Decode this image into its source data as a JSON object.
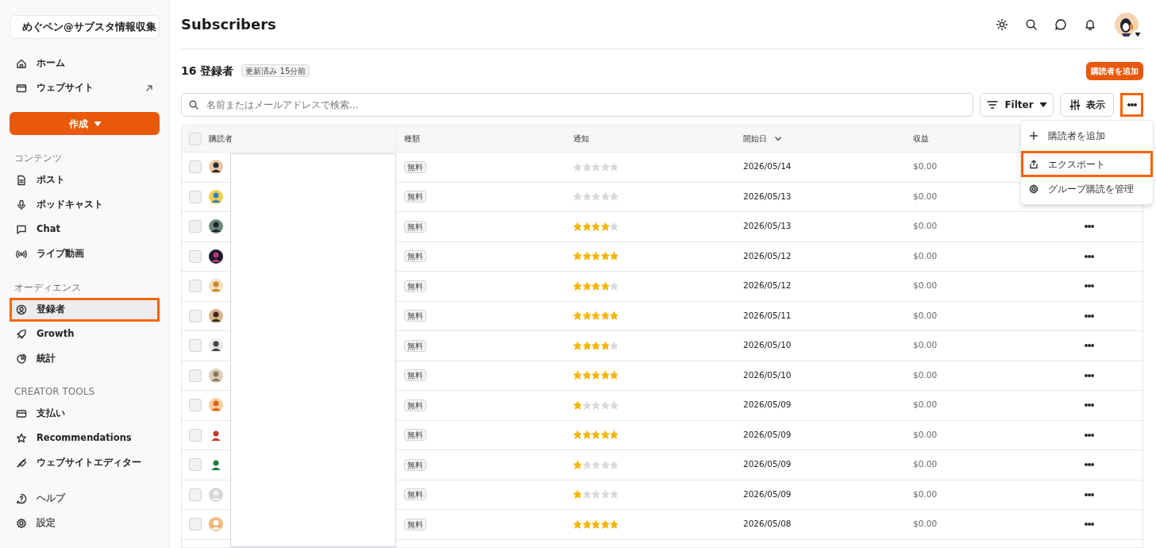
{
  "sidebar": {
    "brand": "めぐペン@サブスタ情報収集",
    "nav": [
      {
        "label": "ホーム",
        "selected": false,
        "highlighted": false,
        "external": false
      },
      {
        "label": "ウェブサイト",
        "selected": false,
        "highlighted": false,
        "external": true
      }
    ],
    "create_button": "作成",
    "sections": [
      {
        "heading": "コンテンツ",
        "items": [
          {
            "label": "ポスト",
            "selected": false,
            "highlighted": false
          },
          {
            "label": "ポッドキャスト",
            "selected": false,
            "highlighted": false
          },
          {
            "label": "Chat",
            "selected": false,
            "highlighted": false
          },
          {
            "label": "ライブ動画",
            "selected": false,
            "highlighted": false
          }
        ]
      },
      {
        "heading": "オーディエンス",
        "items": [
          {
            "label": "登録者",
            "selected": true,
            "highlighted": true
          },
          {
            "label": "Growth",
            "selected": false,
            "highlighted": false
          },
          {
            "label": "統計",
            "selected": false,
            "highlighted": false
          }
        ]
      },
      {
        "heading": "CREATOR TOOLS",
        "items": [
          {
            "label": "支払い",
            "selected": false,
            "highlighted": false
          },
          {
            "label": "Recommendations",
            "selected": false,
            "highlighted": false
          },
          {
            "label": "ウェブサイトエディター",
            "selected": false,
            "highlighted": false
          }
        ]
      }
    ],
    "footer": [
      {
        "label": "ヘルプ",
        "selected": false,
        "highlighted": false
      },
      {
        "label": "設定",
        "selected": false,
        "highlighted": false
      }
    ]
  },
  "header": {
    "title": "Subscribers"
  },
  "summary": {
    "count": "16 登録者",
    "updated": "更新済み 15分前",
    "add_button": "購読者を追加"
  },
  "search": {
    "placeholder": "名前またはメールアドレスで検索..."
  },
  "toolbar": {
    "filter": "Filter",
    "view": "表示",
    "more_highlighted": true
  },
  "table": {
    "all_checked": false,
    "columns": [
      {
        "label": "購読者",
        "sorted": false
      },
      {
        "label": "種類",
        "sorted": false
      },
      {
        "label": "通知",
        "sorted": false
      },
      {
        "label": "開始日",
        "sorted": true
      },
      {
        "label": "収益",
        "sorted": false
      }
    ],
    "rows": [
      {
        "checked": false,
        "type": "無料",
        "stars": 0,
        "start": "2026/05/14",
        "revenue": "$0.00"
      },
      {
        "checked": false,
        "type": "無料",
        "stars": 0,
        "start": "2026/05/13",
        "revenue": "$0.00"
      },
      {
        "checked": false,
        "type": "無料",
        "stars": 4,
        "start": "2026/05/13",
        "revenue": "$0.00"
      },
      {
        "checked": false,
        "type": "無料",
        "stars": 5,
        "start": "2026/05/12",
        "revenue": "$0.00"
      },
      {
        "checked": false,
        "type": "無料",
        "stars": 4,
        "start": "2026/05/12",
        "revenue": "$0.00"
      },
      {
        "checked": false,
        "type": "無料",
        "stars": 5,
        "start": "2026/05/11",
        "revenue": "$0.00"
      },
      {
        "checked": false,
        "type": "無料",
        "stars": 4,
        "start": "2026/05/10",
        "revenue": "$0.00"
      },
      {
        "checked": false,
        "type": "無料",
        "stars": 5,
        "start": "2026/05/10",
        "revenue": "$0.00"
      },
      {
        "checked": false,
        "type": "無料",
        "stars": 1,
        "start": "2026/05/09",
        "revenue": "$0.00"
      },
      {
        "checked": false,
        "type": "無料",
        "stars": 5,
        "start": "2026/05/09",
        "revenue": "$0.00"
      },
      {
        "checked": false,
        "type": "無料",
        "stars": 1,
        "start": "2026/05/09",
        "revenue": "$0.00"
      },
      {
        "checked": false,
        "type": "無料",
        "stars": 1,
        "start": "2026/05/09",
        "revenue": "$0.00"
      },
      {
        "checked": false,
        "type": "無料",
        "stars": 5,
        "start": "2026/05/08",
        "revenue": "$0.00"
      }
    ]
  },
  "menu": {
    "items": [
      {
        "label": "購読者を追加",
        "highlighted": false
      },
      {
        "label": "エクスポート",
        "highlighted": true
      },
      {
        "label": "グループ購読を管理",
        "highlighted": false
      }
    ]
  }
}
